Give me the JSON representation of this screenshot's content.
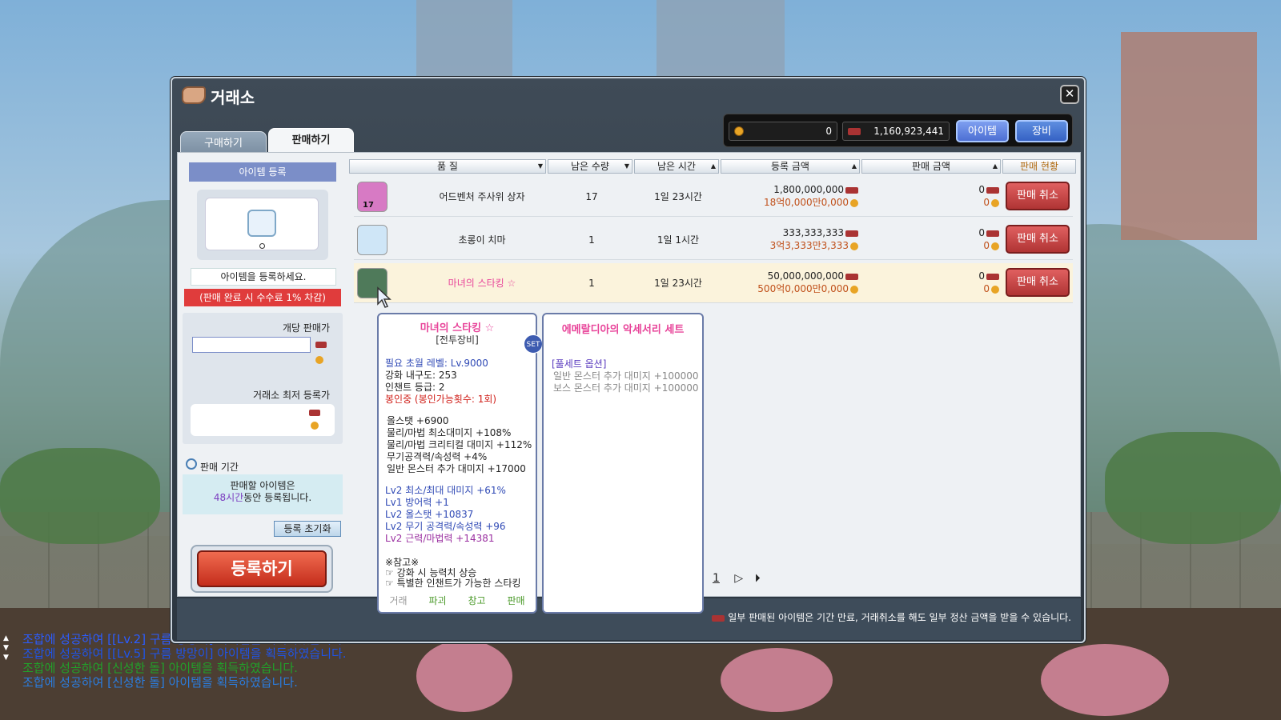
{
  "window": {
    "title": "거래소"
  },
  "tabs": [
    {
      "label": "구매하기"
    },
    {
      "label": "판매하기"
    }
  ],
  "currency": {
    "meso": "0",
    "elv": "1,160,923,441",
    "btn_item": "아이템",
    "btn_equip": "장비"
  },
  "register_panel": {
    "header": "아이템 등록",
    "prompt": "아이템을 등록하세요.",
    "fee_note": "(판매 완료 시 수수료 1% 차감)",
    "unit_price_label": "개당 판매가",
    "min_price_label": "거래소 최저 등록가",
    "period_label": "판매 기간",
    "period_text_1": "판매할 아이템은",
    "period_hours": "48시간",
    "period_text_2": "동안 등록됩니다.",
    "reset_btn": "등록 초기화",
    "register_btn": "등록하기"
  },
  "columns": [
    {
      "label": "품 질"
    },
    {
      "label": "남은 수량"
    },
    {
      "label": "남은 시간"
    },
    {
      "label": "등록 금액"
    },
    {
      "label": "판매 금액"
    },
    {
      "label": "판매 현황"
    }
  ],
  "rows": [
    {
      "name": "어드벤처 주사위 상자",
      "badge": "17",
      "qty": "17",
      "time": "1일 23시간",
      "price_elv": "1,800,000,000",
      "price_meso": "18억0,000만0,000",
      "sold_elv": "0",
      "sold_meso": "0",
      "action": "판매 취소"
    },
    {
      "name": "초롱이 치마",
      "badge": "",
      "qty": "1",
      "time": "1일 1시간",
      "price_elv": "333,333,333",
      "price_meso": "3억3,333만3,333",
      "sold_elv": "0",
      "sold_meso": "0",
      "action": "판매 취소"
    },
    {
      "name": "마녀의 스타킹 ☆",
      "badge": "",
      "qty": "1",
      "time": "1일 23시간",
      "price_elv": "50,000,000,000",
      "price_meso": "500억0,000만0,000",
      "sold_elv": "0",
      "sold_meso": "0",
      "action": "판매 취소"
    }
  ],
  "pager": {
    "page": "1"
  },
  "bottom_note": "일부 판매된 아이템은 기간 만료, 거래취소를 해도 일부 정산 금액을 받을 수 있습니다.",
  "tooltip_item": {
    "name": "마녀의 스타킹 ☆",
    "category": "[전투장비]",
    "req_level": "필요 초월 레벨: Lv.9000",
    "durability": "강화 내구도: 253",
    "enchant": "인챈트 등급: 2",
    "seal": "봉인중 (봉인가능횟수: 1회)",
    "stats": [
      "올스탯 +6900",
      "물리/마법 최소대미지 +108%",
      "물리/마법 크리티컬 대미지 +112%",
      "무기공격력/속성력 +4%",
      "일반 몬스터 추가 대미지 +17000"
    ],
    "potentials": [
      {
        "text": "Lv2 최소/최대 대미지 +61%",
        "color": "blue"
      },
      {
        "text": "Lv1 방어력 +1",
        "color": "blue"
      },
      {
        "text": "Lv2 올스탯 +10837",
        "color": "blue"
      },
      {
        "text": "Lv2 무기 공격력/속성력 +96",
        "color": "blue"
      },
      {
        "text": "Lv2 근력/마법력 +14381",
        "color": "purple"
      }
    ],
    "note_title": "※참고※",
    "notes": [
      "☞ 강화 시 능력치 상승",
      "☞ 특별한 인챈트가 가능한 스타킹"
    ],
    "actions": [
      "거래",
      "파괴",
      "창고",
      "판매"
    ],
    "set_badge": "SET"
  },
  "tooltip_set": {
    "title": "에메랄디아의 악세서리 세트",
    "full_set": "[풀세트 옵션]",
    "options": [
      "일반 몬스터 추가 대미지 +100000",
      "보스 몬스터 추가 대미지 +100000"
    ]
  },
  "chat": [
    "조합에 성공하여 [[Lv.2] 구름 방망이] 아이템을 획득하였습니다.",
    "조합에 성공하여 [[Lv.5] 구름 방망이] 아이템을 획득하였습니다.",
    "조합에 성공하여 [신성한 돌] 아이템을 획득하였습니다.",
    "조합에 성공하여 [신성한 돌] 아이템을 획득하였습니다."
  ]
}
